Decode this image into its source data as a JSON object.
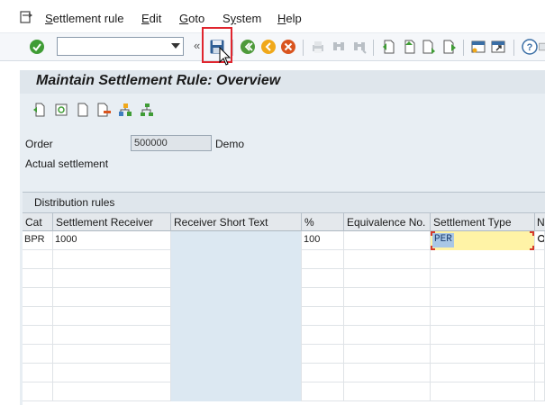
{
  "menubar": {
    "items": [
      {
        "label": "Settlement rule",
        "underline": "S"
      },
      {
        "label": "Edit",
        "underline": "E"
      },
      {
        "label": "Goto",
        "underline": "G"
      },
      {
        "label": "System",
        "underline": "y"
      },
      {
        "label": "Help",
        "underline": "H"
      }
    ]
  },
  "toolbar": {
    "command_value": "",
    "back_glyph": "«",
    "icons": [
      "enter-icon",
      "save-icon",
      "back-icon",
      "exit-icon",
      "cancel-icon",
      "print-icon",
      "find-icon",
      "find-next-icon",
      "first-page-icon",
      "previous-page-icon",
      "next-page-icon",
      "last-page-icon",
      "create-session-icon",
      "shortcut-icon",
      "help-icon"
    ],
    "highlight_color": "#e0252e"
  },
  "page": {
    "title": "Maintain Settlement Rule: Overview"
  },
  "header": {
    "order_label": "Order",
    "order_value": "500000",
    "order_description": "Demo",
    "actual_settlement_label": "Actual settlement"
  },
  "table": {
    "caption": "Distribution rules",
    "columns": [
      "Cat",
      "Settlement Receiver",
      "Receiver Short Text",
      "%",
      "Equivalence No.",
      "Settlement Type",
      "N"
    ],
    "rows": [
      {
        "cat": "BPR",
        "receiver": "1000",
        "short_text": "",
        "percent": "100",
        "equivalence": "",
        "settlement_type": "PER"
      }
    ]
  },
  "colors": {
    "readonly_column": "#dce8f2",
    "selected_cell": "#fff3a6",
    "title_bar": "#dfe6ec"
  }
}
